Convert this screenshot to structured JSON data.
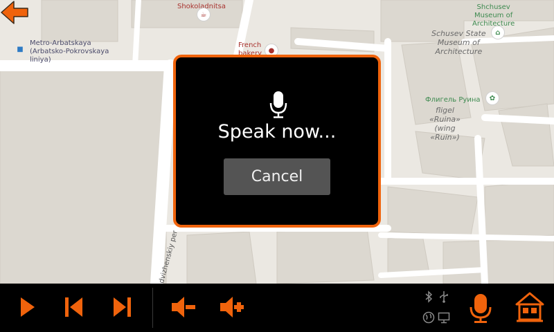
{
  "map": {
    "labels": {
      "shokoladnitsa": "Shokoladnitsa",
      "french_bakery": "French\nbakery",
      "metro": "Metro-Arbatskaya\n(Arbatsko-Pokrovskaya\nliniya)",
      "museum_green": "Shchusev\nMuseum of\nArchitecture",
      "museum_italic": "Schusev State\nMuseum of\nArchitecture",
      "fligel_green": "Флигель Руина",
      "fligel_italic": "fligel\n«Ruina»\n(wing\n«Ruin»)",
      "street": "dvizhenskiy per"
    }
  },
  "dialog": {
    "prompt": "Speak now...",
    "cancel_label": "Cancel"
  },
  "colors": {
    "accent": "#f0630c",
    "dialog_bg": "#000000",
    "button_bg": "#545454",
    "map_bg": "#ebe8e2"
  },
  "toolbar": {
    "buttons": [
      "play-icon",
      "previous-track-icon",
      "next-track-icon",
      "volume-down-icon",
      "volume-up-icon",
      "microphone-icon",
      "home-icon"
    ],
    "status": [
      "bluetooth-icon",
      "usb-icon",
      "globe-icon",
      "monitor-icon"
    ]
  }
}
